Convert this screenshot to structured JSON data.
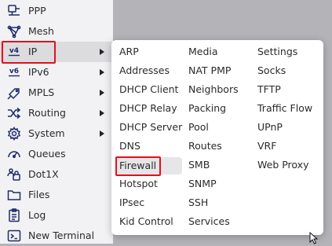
{
  "sidebar": {
    "items": [
      {
        "label": "PPP",
        "icon": "ppp-icon",
        "has_submenu": false
      },
      {
        "label": "Mesh",
        "icon": "mesh-icon",
        "has_submenu": false
      },
      {
        "label": "IP",
        "icon": "ip-v4-icon",
        "has_submenu": true,
        "active": true
      },
      {
        "label": "IPv6",
        "icon": "ip-v6-icon",
        "has_submenu": true
      },
      {
        "label": "MPLS",
        "icon": "mpls-icon",
        "has_submenu": true
      },
      {
        "label": "Routing",
        "icon": "routing-icon",
        "has_submenu": true
      },
      {
        "label": "System",
        "icon": "gear-icon",
        "has_submenu": true
      },
      {
        "label": "Queues",
        "icon": "queues-icon",
        "has_submenu": false
      },
      {
        "label": "Dot1X",
        "icon": "dot1x-icon",
        "has_submenu": false
      },
      {
        "label": "Files",
        "icon": "folder-icon",
        "has_submenu": false
      },
      {
        "label": "Log",
        "icon": "log-icon",
        "has_submenu": false
      },
      {
        "label": "New Terminal",
        "icon": "terminal-icon",
        "has_submenu": false
      }
    ],
    "ip_icon_text": "v4",
    "ipv6_icon_text": "v6"
  },
  "submenu": {
    "columns": [
      [
        "ARP",
        "Addresses",
        "DHCP Client",
        "DHCP Relay",
        "DHCP Server",
        "DNS",
        "Firewall",
        "Hotspot",
        "IPsec",
        "Kid Control"
      ],
      [
        "Media",
        "NAT PMP",
        "Neighbors",
        "Packing",
        "Pool",
        "Routes",
        "SMB",
        "SNMP",
        "SSH",
        "Services"
      ],
      [
        "Settings",
        "Socks",
        "TFTP",
        "Traffic Flow",
        "UPnP",
        "VRF",
        "Web Proxy"
      ]
    ],
    "hovered": "Firewall"
  },
  "colors": {
    "highlight_border": "#e3101d",
    "sidebar_bg": "#f2f2f4",
    "backdrop": "#b3b3b8",
    "icon_color": "#1f2a6b"
  }
}
